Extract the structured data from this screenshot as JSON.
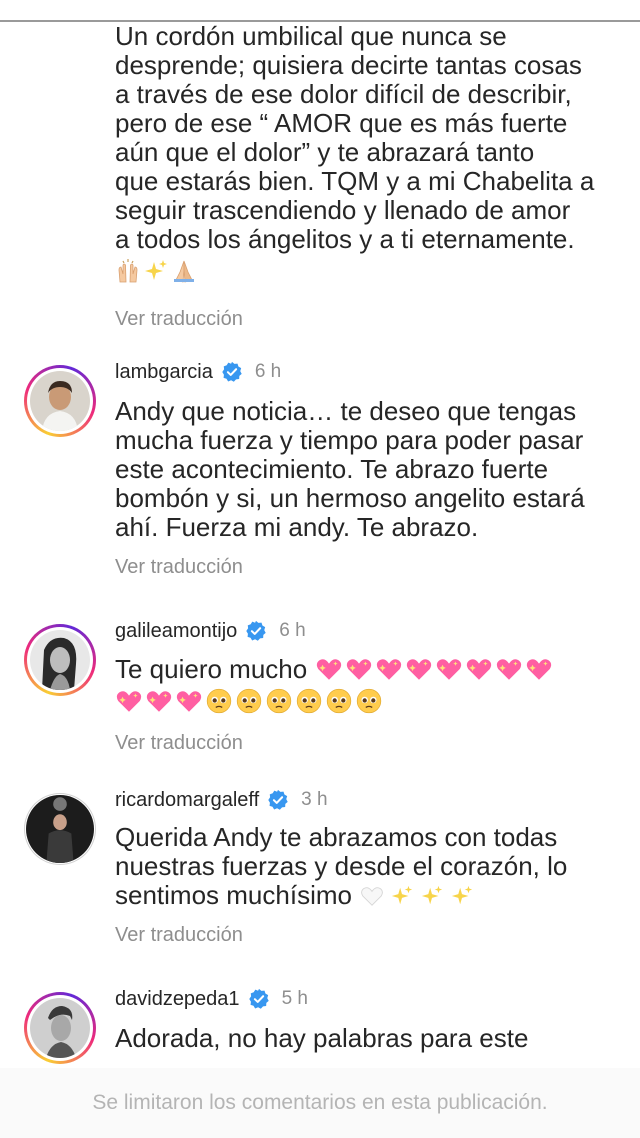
{
  "first_comment": {
    "lines": [
      "Un cordón umbilical que nunca se",
      "desprende; quisiera decirte tantas cosas",
      "a través de ese dolor difícil de describir,",
      "pero de ese “ AMOR que es más fuerte",
      "aún que el dolor” y te abrazará tanto",
      "que estarás bien. TQM y a mi Chabelita a",
      "seguir trascendiendo y llenado de amor",
      "a todos los ángelitos y a ti eternamente."
    ],
    "emojis": [
      "raising-hands",
      "sparkles",
      "folded-hands"
    ],
    "translate": "Ver traducción"
  },
  "comments": [
    {
      "username": "lambgarcia",
      "time": "6 h",
      "lines": [
        "Andy que noticia… te deseo que tengas",
        "mucha fuerza y tiempo para poder pasar",
        "este acontecimiento. Te abrazo fuerte",
        "bombón y si, un hermoso angelito estará",
        "ahí. Fuerza mi andy. Te abrazo."
      ],
      "translate": "Ver traducción"
    },
    {
      "username": "galileamontijo",
      "time": "6 h",
      "text": "Te quiero mucho",
      "emoji_row1": [
        "sparkling-heart",
        "sparkling-heart",
        "sparkling-heart",
        "sparkling-heart",
        "sparkling-heart",
        "sparkling-heart",
        "sparkling-heart",
        "sparkling-heart"
      ],
      "emoji_row2": [
        "sparkling-heart",
        "sparkling-heart",
        "sparkling-heart",
        "pleading-face",
        "pleading-face",
        "pleading-face",
        "pleading-face",
        "pleading-face",
        "pleading-face"
      ],
      "translate": "Ver traducción"
    },
    {
      "username": "ricardomargaleff",
      "time": "3 h",
      "lines": [
        "Querida Andy te abrazamos con todas",
        "nuestras fuerzas y desde el corazón, lo",
        "sentimos muchísimo"
      ],
      "emojis": [
        "white-heart",
        "sparkles",
        "sparkles",
        "sparkles"
      ],
      "translate": "Ver traducción"
    },
    {
      "username": "davidzepeda1",
      "time": "5 h",
      "lines": [
        "Adorada, no hay palabras para este"
      ]
    }
  ],
  "footer": {
    "limited_text": "Se limitaron los comentarios en esta publicación."
  },
  "colors": {
    "text": "#262626",
    "muted": "#8e8e8e",
    "verified": "#3897f0",
    "heart": "#ff5fa2"
  }
}
